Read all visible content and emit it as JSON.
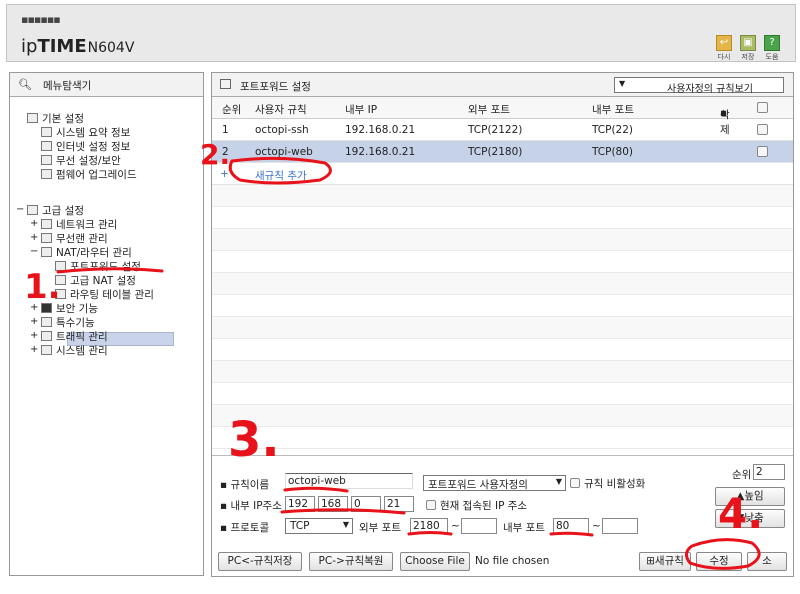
{
  "header": {
    "brand_ip": "ip",
    "brand_time": "TIME",
    "model": "N604V",
    "buttons": [
      {
        "label": "다시",
        "icon": "undo-icon"
      },
      {
        "label": "저장",
        "icon": "save-icon"
      },
      {
        "label": "도움",
        "icon": "help-icon"
      }
    ]
  },
  "sidebar": {
    "title": "메뉴탐색기",
    "basic": {
      "label": "기본 설정",
      "items": [
        "시스템 요약 정보",
        "인터넷 설정 정보",
        "무선 설정/보안",
        "펌웨어 업그레이드"
      ]
    },
    "advanced": {
      "label": "고급 설정",
      "items": [
        "네트워크 관리",
        "무선랜 관리",
        "NAT/라우터 관리"
      ],
      "nat_children": [
        "포트포워드 설정",
        "고급 NAT 설정",
        "라우팅 테이블 관리"
      ],
      "more": [
        "보안 기능",
        "특수기능",
        "트래픽 관리",
        "시스템 관리"
      ]
    }
  },
  "main": {
    "title": "포트포워드 설정",
    "view_select": "사용자정의 규칙보기",
    "columns": {
      "no": "순위",
      "name": "사용자 규칙",
      "ip": "내부 IP",
      "ext": "외부 포트",
      "int": "내부 포트",
      "del": "삭제"
    },
    "rules": [
      {
        "no": "1",
        "name": "octopi-ssh",
        "ip": "192.168.0.21",
        "ext": "TCP(2122)",
        "int": "TCP(22)"
      },
      {
        "no": "2",
        "name": "octopi-web",
        "ip": "192.168.0.21",
        "ext": "TCP(2180)",
        "int": "TCP(80)"
      }
    ],
    "add_rule": "새규칙 추가"
  },
  "form": {
    "name_label": "규칙이름",
    "name_value": "octopi-web",
    "type_select": "포트포워드 사용자정의",
    "disable_label": "규칙 비활성화",
    "ip_label": "내부 IP주소",
    "ip": [
      "192",
      "168",
      "0",
      "21"
    ],
    "current_ip_label": "현재 접속된 IP 주소",
    "proto_label": "프로토콜",
    "proto_value": "TCP",
    "ext_port_label": "외부 포트",
    "ext_port_from": "2180",
    "ext_port_to": "",
    "int_port_label": "내부 포트",
    "int_port_from": "80",
    "int_port_to": "",
    "order_label": "순위",
    "order_value": "2",
    "up_button": "높임",
    "down_button": "낮춤",
    "save_pc": "PC<-규칙저장",
    "restore_pc": "PC->규칙복원",
    "choose_file": "Choose File",
    "no_file": "No file chosen",
    "new_rule": "새규칙",
    "modify": "수정",
    "cancel": "소"
  },
  "annotations": [
    "1.",
    "2.",
    "3.",
    "4."
  ],
  "colors": {
    "annotation": "#e8121a",
    "selected_row": "#c6d2e8"
  }
}
